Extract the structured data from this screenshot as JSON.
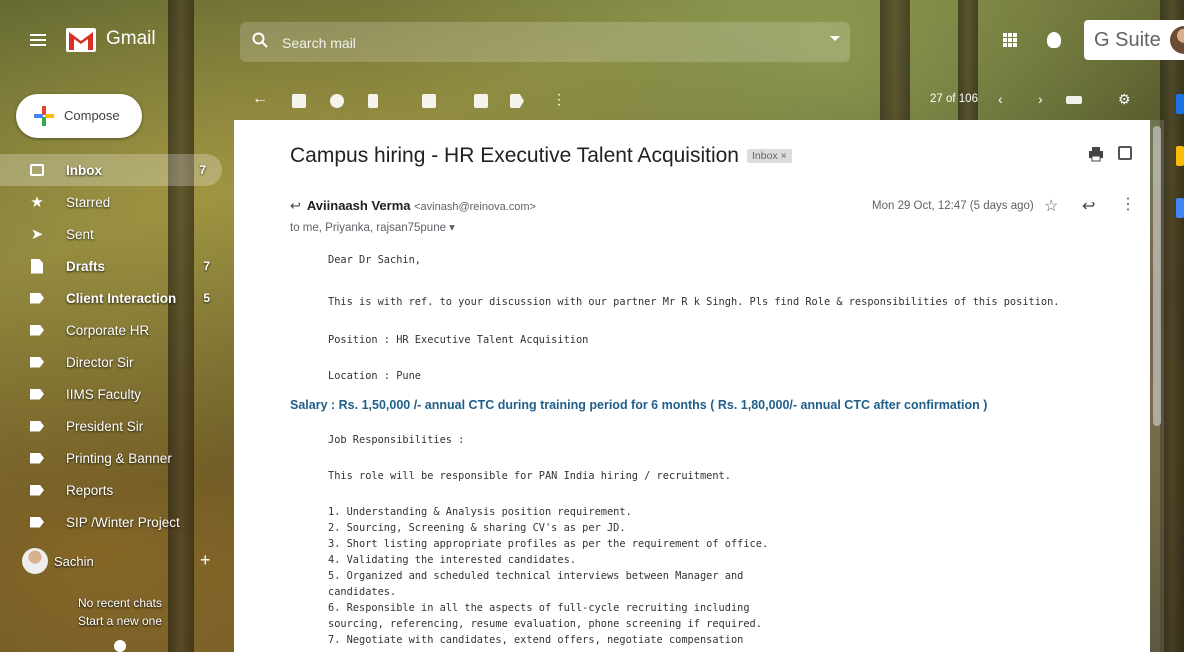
{
  "app": {
    "name": "Gmail",
    "suite": "G Suite"
  },
  "search": {
    "placeholder": "Search mail"
  },
  "compose": {
    "label": "Compose"
  },
  "sidebar": {
    "items": [
      {
        "label": "Inbox",
        "count": "7",
        "icon": "inbox-icon",
        "bold": true
      },
      {
        "label": "Starred",
        "count": "",
        "icon": "star-icon"
      },
      {
        "label": "Sent",
        "count": "",
        "icon": "send-icon"
      },
      {
        "label": "Drafts",
        "count": "7",
        "icon": "draft-icon",
        "bold": true
      },
      {
        "label": "Client Interaction",
        "count": "5",
        "icon": "label-icon",
        "bold": true
      },
      {
        "label": "Corporate HR",
        "count": "",
        "icon": "label-icon"
      },
      {
        "label": "Director Sir",
        "count": "",
        "icon": "label-icon"
      },
      {
        "label": "IIMS Faculty",
        "count": "",
        "icon": "label-icon"
      },
      {
        "label": "President Sir",
        "count": "",
        "icon": "label-icon"
      },
      {
        "label": "Printing & Banner",
        "count": "",
        "icon": "label-icon"
      },
      {
        "label": "Reports",
        "count": "",
        "icon": "label-icon"
      },
      {
        "label": "SIP /Winter Project",
        "count": "",
        "icon": "label-icon"
      }
    ]
  },
  "hangouts": {
    "user": "Sachin",
    "no_chats": "No recent chats",
    "start_new": "Start a new one"
  },
  "toolbar": {
    "pager": "27 of 106"
  },
  "email": {
    "subject": "Campus hiring - HR Executive Talent Acquisition",
    "tag": "Inbox ×",
    "sender_name": "Aviinaash Verma",
    "sender_email": "<avinash@reinova.com>",
    "recipients": "to me, Priyanka, rajsan75pune ▾",
    "date": "Mon 29 Oct, 12:47 (5 days ago)",
    "body": {
      "greeting": "Dear Dr Sachin,",
      "intro": "This is with ref. to your discussion with our partner Mr R k Singh. Pls find Role & responsibilities of this position.",
      "position": "Position : HR Executive Talent Acquisition",
      "location": "Location : Pune",
      "salary": "Salary : Rs. 1,50,000 /-  annual CTC during training period for 6 months ( Rs. 1,80,000/- annual CTC after confirmation )",
      "resp_heading": "Job Responsibilities :",
      "resp_intro": "This role will be responsible for PAN India hiring / recruitment.",
      "list": [
        "1. Understanding & Analysis position requirement.",
        "2. Sourcing, Screening & sharing CV's as per JD.",
        "3. Short listing appropriate profiles as per the requirement of office.",
        "4. Validating the interested candidates.",
        "5. Organized and scheduled technical interviews between Manager and",
        "candidates.",
        "6. Responsible in all the aspects of full-cycle recruiting including",
        "sourcing, referencing, resume evaluation, phone screening if required.",
        "7. Negotiate with candidates, extend offers, negotiate compensation"
      ]
    }
  },
  "colors": {
    "gmail_red": "#d93025",
    "compose_red": "#ea4335",
    "salary_blue": "#1f5f8a"
  }
}
